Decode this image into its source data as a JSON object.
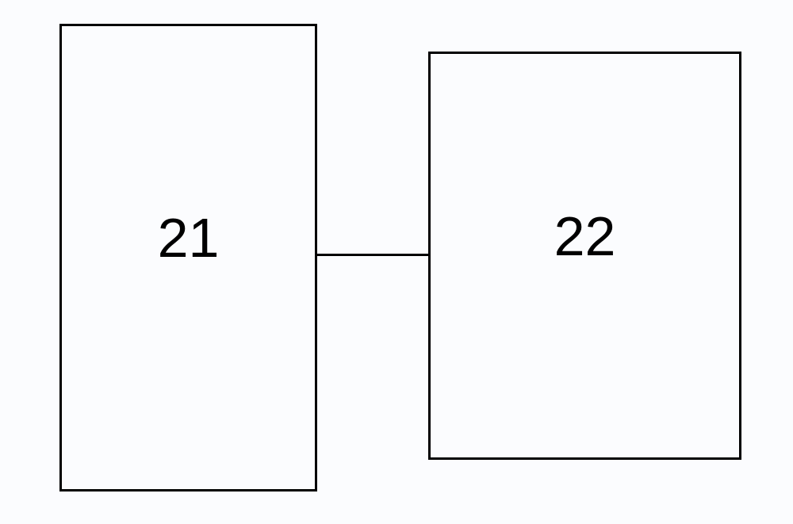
{
  "diagram": {
    "boxes": [
      {
        "label": "21"
      },
      {
        "label": "22"
      }
    ]
  }
}
